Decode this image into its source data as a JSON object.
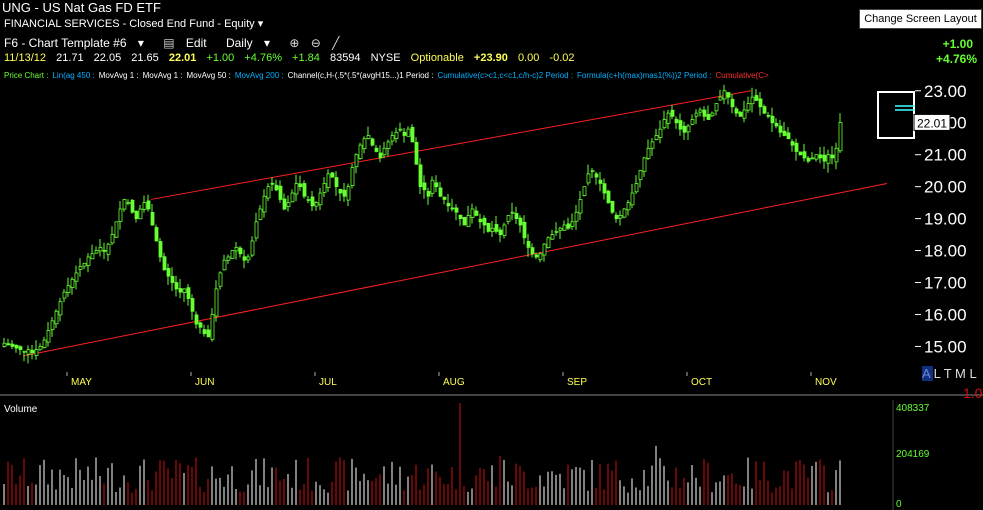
{
  "header": {
    "title": "UNG - US Nat Gas FD ETF",
    "sector": "FINANCIAL SERVICES - Closed End Fund - Equity",
    "change_layout_button": "Change Screen Layout",
    "chart_template": "F6 - Chart Template #6",
    "edit_label": "Edit",
    "period_label": "Daily",
    "right_change_abs": "+1.00",
    "right_change_pct": "+4.76%"
  },
  "quote": {
    "date": "11/13/12",
    "open": "21.71",
    "high": "22.05",
    "low": "21.65",
    "last": "22.01",
    "change": "+1.00",
    "change_pct": "+4.76%",
    "change2": "+1.84",
    "volume": "83594",
    "exchange": "NYSE",
    "optionable": "Optionable",
    "extra": "+23.90",
    "v1": "0.00",
    "v2": "-0.02"
  },
  "indicators": [
    {
      "text": "Price Chart :",
      "color": "#66ff33"
    },
    {
      "text": "Lin(ag 450 :",
      "color": "#00b0ff"
    },
    {
      "text": "MovAvg 1 :",
      "color": "#ffffff"
    },
    {
      "text": "MovAvg 1 :",
      "color": "#ffffff"
    },
    {
      "text": "MovAvg 50 :",
      "color": "#ffffff"
    },
    {
      "text": "MovAvg 200 :",
      "color": "#00b0ff"
    },
    {
      "text": "Channel(c,H-(.5*(.5*(avgH15...)1 Period :",
      "color": "#ffffff"
    },
    {
      "text": "Cumulative(c>c1,c<c1,c/h-c)2 Period :",
      "color": "#00b0ff"
    },
    {
      "text": "Formula(c+h(max)mas1(%))2 Period :",
      "color": "#00b0ff"
    },
    {
      "text": "Cumulative(C>",
      "color": "#ff3030"
    }
  ],
  "price_panel": {
    "last_price_label": "22.01",
    "alt_label": "A L T M L",
    "corner_value": "1.0"
  },
  "volume_panel": {
    "label": "Volume",
    "ticks": [
      "408337",
      "204169",
      "0"
    ]
  },
  "chart_data": {
    "type": "candlestick",
    "ylim": [
      14.2,
      23.4
    ],
    "yticks": [
      15.0,
      16.0,
      17.0,
      18.0,
      19.0,
      20.0,
      21.0,
      22.0,
      23.0
    ],
    "ytick_labels": [
      "15.00",
      "16.00",
      "17.00",
      "18.00",
      "19.00",
      "20.00",
      "21.00",
      "22.00",
      "23.00"
    ],
    "month_labels": [
      "MAY",
      "JUN",
      "JUL",
      "AUG",
      "SEP",
      "OCT",
      "NOV"
    ],
    "month_start_index": [
      16,
      47,
      78,
      109,
      140,
      171,
      202
    ],
    "channel_upper": {
      "from": [
        37,
        19.6
      ],
      "to": [
        187,
        23.0
      ]
    },
    "channel_lower": {
      "from": [
        5,
        14.7
      ],
      "to": [
        221,
        20.1
      ]
    },
    "closes": [
      15.1,
      15.05,
      15.0,
      14.95,
      14.9,
      14.85,
      14.9,
      14.8,
      14.9,
      15.0,
      15.2,
      15.5,
      15.8,
      16.1,
      16.4,
      16.7,
      16.9,
      17.1,
      17.3,
      17.5,
      17.6,
      17.8,
      17.9,
      18.0,
      18.1,
      18.0,
      18.2,
      18.5,
      18.9,
      19.3,
      19.6,
      19.5,
      19.2,
      19.0,
      19.3,
      19.5,
      19.3,
      18.8,
      18.3,
      17.8,
      17.4,
      17.2,
      17.0,
      16.8,
      16.7,
      16.8,
      16.5,
      16.1,
      15.7,
      15.6,
      15.4,
      15.3,
      16.0,
      16.8,
      17.3,
      17.7,
      17.8,
      18.0,
      18.1,
      17.9,
      17.7,
      17.8,
      18.3,
      18.9,
      19.3,
      19.7,
      20.0,
      20.1,
      19.9,
      19.6,
      19.3,
      19.5,
      19.8,
      20.1,
      20.0,
      19.7,
      19.6,
      19.4,
      19.5,
      19.8,
      20.1,
      20.4,
      20.3,
      20.0,
      19.8,
      19.7,
      20.0,
      20.6,
      21.0,
      21.3,
      21.5,
      21.6,
      21.3,
      21.1,
      20.9,
      21.2,
      21.4,
      21.6,
      21.7,
      21.8,
      21.6,
      21.8,
      21.4,
      20.7,
      20.0,
      19.9,
      19.7,
      20.2,
      20.0,
      19.7,
      19.6,
      19.4,
      19.3,
      19.2,
      19.0,
      18.8,
      19.1,
      19.3,
      19.1,
      18.9,
      18.8,
      18.6,
      18.7,
      18.6,
      18.5,
      18.8,
      19.1,
      19.2,
      19.0,
      18.8,
      18.4,
      18.1,
      17.9,
      17.8,
      17.9,
      18.2,
      18.4,
      18.5,
      18.6,
      18.7,
      18.8,
      18.7,
      18.9,
      19.2,
      19.6,
      20.0,
      20.4,
      20.5,
      20.3,
      20.1,
      19.8,
      19.5,
      19.2,
      19.0,
      19.1,
      19.3,
      19.5,
      19.8,
      20.1,
      20.5,
      20.9,
      21.2,
      21.4,
      21.6,
      21.8,
      22.1,
      22.3,
      22.2,
      22.0,
      21.8,
      21.7,
      21.9,
      22.1,
      22.3,
      22.4,
      22.2,
      22.1,
      22.3,
      22.6,
      22.8,
      23.0,
      22.8,
      22.5,
      22.3,
      22.2,
      22.4,
      22.6,
      22.8,
      22.7,
      22.5,
      22.3,
      22.2,
      22.0,
      21.9,
      21.7,
      21.6,
      21.5,
      21.3,
      21.1,
      21.0,
      20.9,
      20.8,
      20.9,
      21.0,
      20.9,
      20.8,
      21.0,
      20.9,
      21.2,
      22.01
    ],
    "volume_max": 408337
  }
}
